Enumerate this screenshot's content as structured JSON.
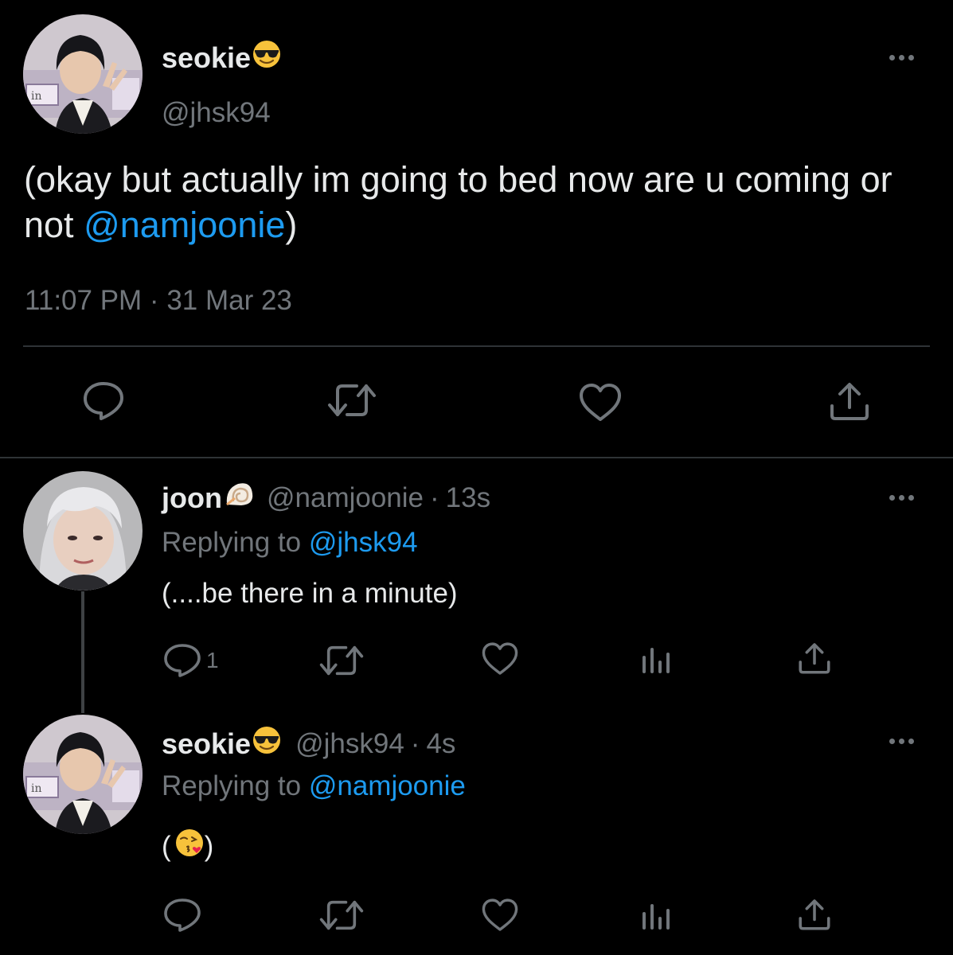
{
  "main_tweet": {
    "display_name": "seokie",
    "name_emoji": "smiling-face-with-sunglasses",
    "handle": "@jhsk94",
    "text_before": "(okay but actually im going to bed now are u coming or not ",
    "mention": "@namjoonie",
    "text_after": ")",
    "timestamp": "11:07 PM · 31 Mar 23",
    "actions": [
      "reply-icon",
      "retweet-icon",
      "like-icon",
      "share-icon"
    ]
  },
  "replies": [
    {
      "display_name": "joon",
      "name_emoji": "spiral-shell",
      "handle": "@namjoonie",
      "separator": "·",
      "time": "13s",
      "replying_label": "Replying to ",
      "replying_to": "@jhsk94",
      "text": "(....be there in a minute)",
      "reply_count": "1",
      "actions": [
        "reply-icon",
        "retweet-icon",
        "like-icon",
        "views-icon",
        "share-icon"
      ]
    },
    {
      "display_name": "seokie",
      "name_emoji": "smiling-face-with-sunglasses",
      "handle": "@jhsk94",
      "separator": "·",
      "time": "4s",
      "replying_label": "Replying to ",
      "replying_to": "@namjoonie",
      "text_before": "(",
      "body_emoji": "face-blowing-a-kiss",
      "text_after": " )",
      "actions": [
        "reply-icon",
        "retweet-icon",
        "like-icon",
        "views-icon",
        "share-icon"
      ]
    }
  ],
  "colors": {
    "background": "#000000",
    "primary_text": "#e7e9ea",
    "secondary_text": "#71767b",
    "accent": "#1d9bf0",
    "divider": "#2f3336"
  }
}
